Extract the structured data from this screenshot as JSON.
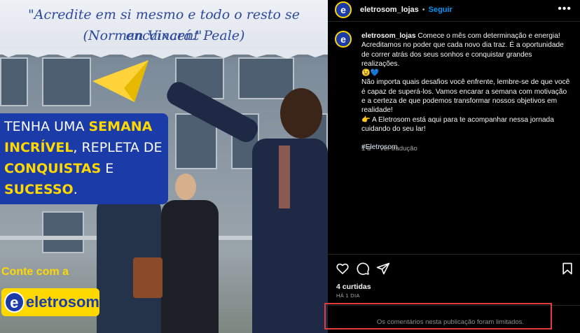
{
  "post_image": {
    "quote_line1": "\"Acredite em si mesmo e todo o resto se encaixará.\"",
    "quote_line2": "(Norman Vincent Peale)",
    "banner": {
      "l1_a": "TENHA UMA ",
      "l1_b": "SEMANA",
      "l2_a": "INCRÍVEL",
      "l2_b": ", REPLETA DE",
      "l3_a": "CONQUISTAS",
      "l3_b": " E",
      "l4_a": "SUCESSO",
      "l4_b": "."
    },
    "conte": "Conte com a",
    "logo_letter": "e",
    "logo_text": "eletrosom"
  },
  "header": {
    "avatar_letter": "e",
    "username": "eletrosom_lojas",
    "dot": "•",
    "follow": "Seguir",
    "more": "•••"
  },
  "caption": {
    "username": "eletrosom_lojas",
    "p1": " Comece o mês com determinação e energia! Acreditamos no poder que cada novo dia traz. É a oportunidade de correr atrás dos seus sonhos e conquistar grandes realizações.",
    "emoji1": "😉💙",
    "p2": "Não importa quais desafios você enfrente, lembre-se de que você é capaz de superá-los. Vamos encarar a semana com motivação e a certeza de que podemos transformar nossos objetivos em realidade!",
    "p3": "👉 A Eletrosom está aqui para te acompanhar nessa jornada cuidando do seu lar!",
    "hashtag": "#Eletrosom",
    "time": "1 d",
    "translate": "Ver tradução"
  },
  "actions": {
    "icons": [
      "heart-icon",
      "comment-icon",
      "share-icon",
      "bookmark-icon"
    ]
  },
  "stats": {
    "likes": "4 curtidas",
    "ago": "HÁ 1 DIA"
  },
  "comments_limited": "Os comentários nesta publicação foram limitados.",
  "colors": {
    "brand_blue": "#1b3ba8",
    "brand_yellow": "#ffd800",
    "follow_blue": "#0095f6",
    "highlight_red": "#e53b3b"
  }
}
